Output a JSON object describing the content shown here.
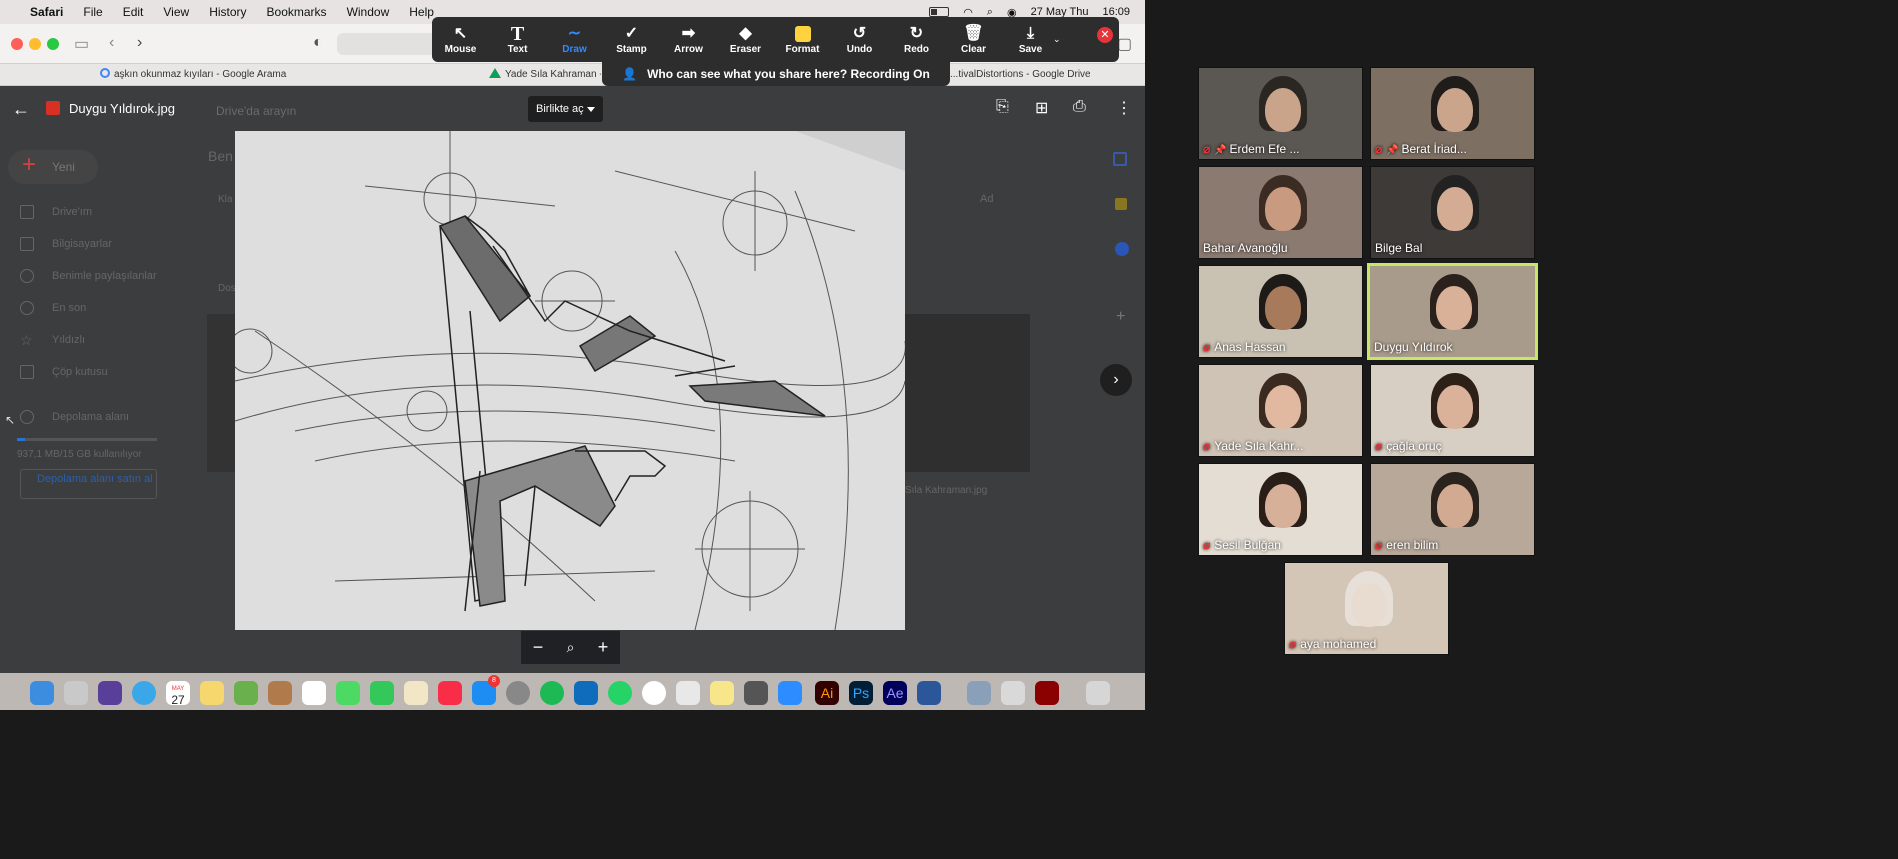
{
  "menubar": {
    "app": "Safari",
    "items": [
      "File",
      "Edit",
      "View",
      "History",
      "Bookmarks",
      "Window",
      "Help"
    ],
    "date": "27 May Thu",
    "time": "16:09"
  },
  "tabs": [
    {
      "label": "aşkın okunmaz kıyıları - Google Arama",
      "icon": "google-icon"
    },
    {
      "label": "Yade Sıla Kahraman - G",
      "icon": "drive-icon"
    },
    {
      "label": "...tivalDistortions - Google Drive",
      "icon": "drive-icon"
    }
  ],
  "annotate": {
    "tools": [
      {
        "name": "mouse",
        "label": "Mouse",
        "icon": "↖"
      },
      {
        "name": "text",
        "label": "Text",
        "icon": "T"
      },
      {
        "name": "draw",
        "label": "Draw",
        "icon": "∼",
        "active": true
      },
      {
        "name": "stamp",
        "label": "Stamp",
        "icon": "✓"
      },
      {
        "name": "arrow",
        "label": "Arrow",
        "icon": "➡"
      },
      {
        "name": "eraser",
        "label": "Eraser",
        "icon": "◆"
      },
      {
        "name": "format",
        "label": "Format",
        "icon": "■"
      },
      {
        "name": "undo",
        "label": "Undo",
        "icon": "↺"
      },
      {
        "name": "redo",
        "label": "Redo",
        "icon": "↻"
      },
      {
        "name": "clear",
        "label": "Clear",
        "icon": "🗑"
      },
      {
        "name": "save",
        "label": "Save",
        "icon": "⤓"
      }
    ],
    "format_color": "#ffd23f",
    "banner": "Who can see what you share here? Recording On"
  },
  "drive": {
    "file_name": "Duygu Yıldırok.jpg",
    "search_placeholder": "Drive'da arayın",
    "open_with": "Birlikte aç",
    "sidebar": {
      "new": "Yeni",
      "items": [
        "Drive'ım",
        "Bilgisayarlar",
        "Benimle paylaşılanlar",
        "En son",
        "Yıldızlı",
        "Çöp kutusu"
      ],
      "storage_title": "Depolama alanı",
      "storage_used": "937,1 MB/15 GB kullanılıyor",
      "storage_fraction": 0.06,
      "buy_storage": "Depolama alanı satın al"
    },
    "bg_labels": {
      "heading": "Ben",
      "sort": "Ad",
      "file_caption": "Sıla Kahraman.jpg",
      "k": "Kla",
      "d": "Dos"
    }
  },
  "participants": [
    {
      "name": "Erdem Efe ...",
      "muted": true,
      "pinned": true
    },
    {
      "name": "Berat İriad...",
      "muted": true,
      "pinned": true
    },
    {
      "name": "Bahar Avanoğlu",
      "muted": false
    },
    {
      "name": "Bilge Bal",
      "muted": false
    },
    {
      "name": "Anas Hassan",
      "muted": true
    },
    {
      "name": "Duygu Yıldırok",
      "muted": false,
      "speaking": true
    },
    {
      "name": "Yade Sıla Kahr...",
      "muted": true
    },
    {
      "name": "çağla oruç",
      "muted": true
    },
    {
      "name": "Sesil Bulğan",
      "muted": true
    },
    {
      "name": "eren bilim",
      "muted": true
    },
    {
      "name": "aya mohamed",
      "muted": true
    }
  ],
  "dock": {
    "calendar_month": "MAY",
    "calendar_day": "27",
    "badge": "8"
  }
}
